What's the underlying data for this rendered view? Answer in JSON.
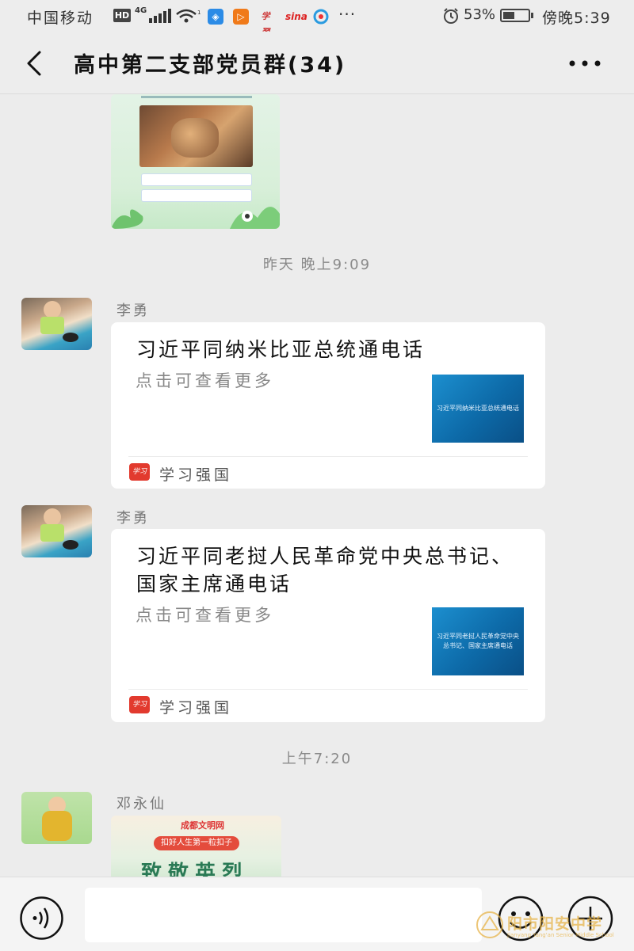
{
  "status_bar": {
    "carrier": "中国移动",
    "hd": "HD",
    "network": "4G",
    "network2": "4G+",
    "apps": [
      "shield-app",
      "play-app",
      "study-app",
      "sina",
      "weibo-circle"
    ],
    "more": "···",
    "battery_percent": "53%",
    "battery_level": 0.53,
    "time": "傍晚5:39"
  },
  "header": {
    "title": "高中第二支部党员群(34)"
  },
  "chat": {
    "timestamps": [
      "昨天 晚上9:09",
      "上午7:20"
    ],
    "messages": [
      {
        "sender": "李勇",
        "card_title": "习近平同纳米比亚总统通电话",
        "card_desc": "点击可查看更多",
        "thumb_text": "习近平同纳米比亚总统通电话",
        "source_icon_text": "学习",
        "source": "学习强国"
      },
      {
        "sender": "李勇",
        "card_title": "习近平同老挝人民革命党中央总书记、国家主席通电话",
        "card_desc": "点击可查看更多",
        "thumb_text": "习近平同老挝人民革命党中央总书记、国家主席通电话",
        "source_icon_text": "学习",
        "source": "学习强国"
      },
      {
        "sender": "邓永仙",
        "image_badge": "成都文明网",
        "image_subtitle": "扣好人生第一粒扣子",
        "image_headline": "致敬英烈"
      }
    ]
  },
  "input_bar": {
    "placeholder": "",
    "watermark": "阳市阳安中学",
    "watermark_sub": "Jianyang Yang'an Senior Middle School"
  },
  "colors": {
    "background": "#ececec",
    "card": "#ffffff",
    "source_red": "#e23a2e",
    "thumb_blue": "#0d6aa8"
  }
}
